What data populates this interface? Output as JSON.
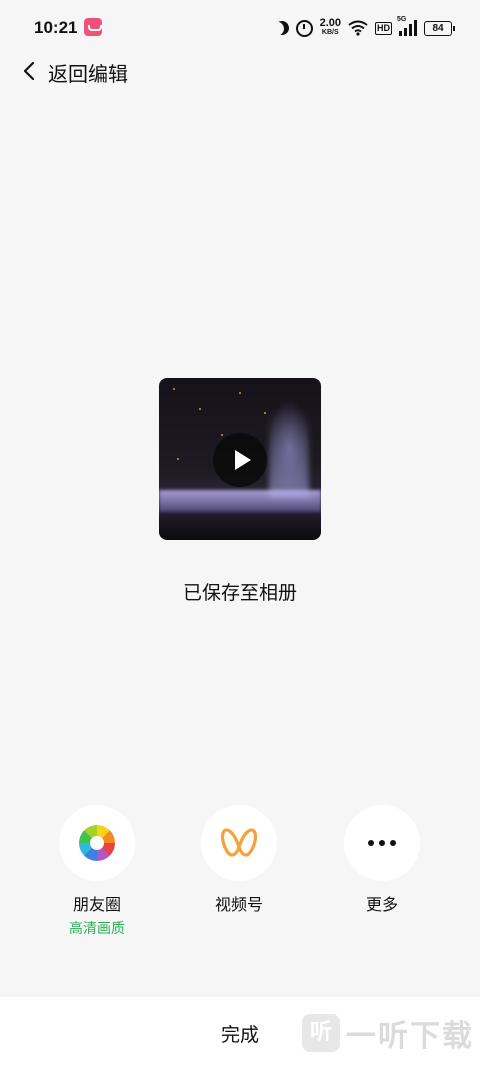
{
  "status_bar": {
    "time": "10:21",
    "network_speed_value": "2.00",
    "network_speed_unit": "KB/S",
    "hd_label": "HD",
    "signal_tag": "5G",
    "battery": "84"
  },
  "header": {
    "back_label": "返回编辑"
  },
  "media": {
    "saved_message": "已保存至相册"
  },
  "share_targets": [
    {
      "label": "朋友圈",
      "sublabel": "高清画质",
      "icon": "moments-aperture-icon"
    },
    {
      "label": "视频号",
      "icon": "channels-butterfly-icon"
    },
    {
      "label": "更多",
      "icon": "more-dots-icon"
    }
  ],
  "bottom": {
    "done_label": "完成",
    "watermark_logo": "听",
    "watermark_text": "一听下载"
  },
  "colors": {
    "background": "#f6f6f6",
    "accent_green": "#2bb15a",
    "channels_orange": "#f3a33a"
  }
}
